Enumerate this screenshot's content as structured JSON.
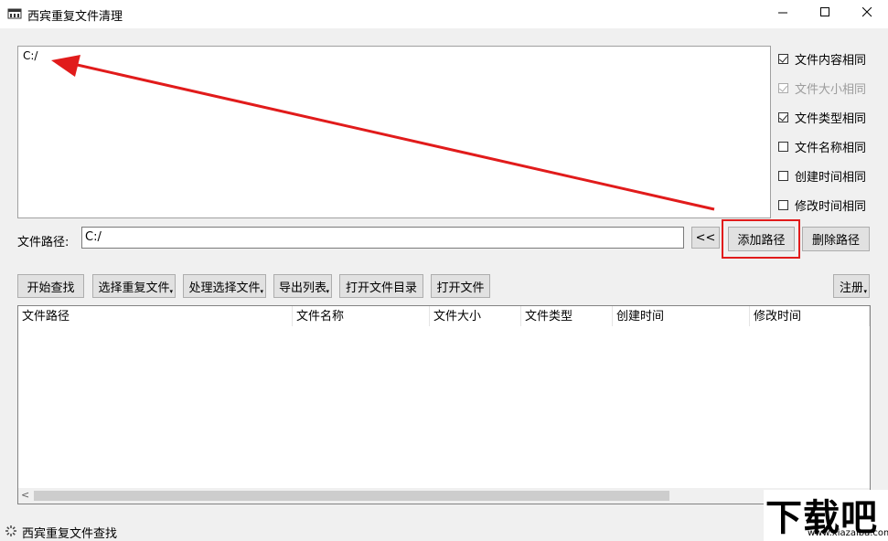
{
  "window": {
    "title": "西宾重复文件清理",
    "controls": [
      "minimize",
      "maximize",
      "close"
    ]
  },
  "path_list": {
    "items": [
      "C:/"
    ]
  },
  "options": [
    {
      "label": "文件内容相同",
      "checked": true,
      "enabled": true
    },
    {
      "label": "文件大小相同",
      "checked": true,
      "enabled": false
    },
    {
      "label": "文件类型相同",
      "checked": true,
      "enabled": true
    },
    {
      "label": "文件名称相同",
      "checked": false,
      "enabled": true
    },
    {
      "label": "创建时间相同",
      "checked": false,
      "enabled": true
    },
    {
      "label": "修改时间相同",
      "checked": false,
      "enabled": true
    }
  ],
  "path_row": {
    "label": "文件路径:",
    "value": "C:/",
    "browse_label": "<<",
    "add_label": "添加路径",
    "remove_label": "删除路径"
  },
  "toolbar": {
    "start": "开始查找",
    "select_dup": "选择重复文件",
    "process_sel": "处理选择文件",
    "export_list": "导出列表",
    "open_dir": "打开文件目录",
    "open_file": "打开文件",
    "register": "注册"
  },
  "table": {
    "columns": [
      "文件路径",
      "文件名称",
      "文件大小",
      "文件类型",
      "创建时间",
      "修改时间"
    ],
    "rows": []
  },
  "status": {
    "text": "西宾重复文件查找"
  },
  "watermark": {
    "main": "下载吧",
    "sub": "www.xiazaiba.com"
  },
  "colors": {
    "highlight": "#e11b1b",
    "arrow": "#e11b1b"
  }
}
